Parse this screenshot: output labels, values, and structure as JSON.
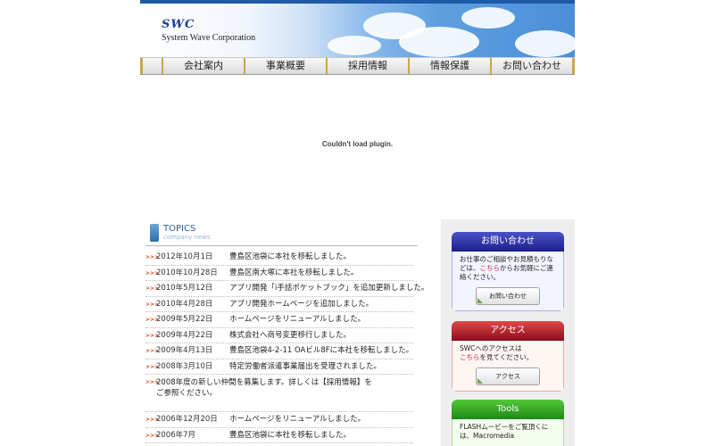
{
  "header": {
    "logo_mark": "SWC",
    "logo_sub": "System Wave Corporation"
  },
  "nav": {
    "items": [
      {
        "label": "会社案内"
      },
      {
        "label": "事業概要"
      },
      {
        "label": "採用情報"
      },
      {
        "label": "情報保護"
      },
      {
        "label": "お問い合わせ"
      }
    ]
  },
  "plugin": {
    "message": "Couldn't load plugin."
  },
  "topics": {
    "title": "TOPICS",
    "subtitle": "company news",
    "bullet": ">>>",
    "items": [
      {
        "date": "2012年10月1日",
        "text": "豊島区池袋に本社を移転しました。"
      },
      {
        "date": "2010年10月28日",
        "text": "豊島区南大塚に本社を移転しました。"
      },
      {
        "date": "2010年5月12日",
        "text": "アプリ開発「i手話ポケットブック」を追加更新しました。"
      },
      {
        "date": "2010年4月28日",
        "text": "アプリ開発ホームページを追加しました。"
      },
      {
        "date": "2009年5月22日",
        "text": "ホームページをリニューアルしました。"
      },
      {
        "date": "2009年4月22日",
        "text": "株式会社へ商号変更移行しました。"
      },
      {
        "date": "2009年4月13日",
        "text": "豊島区池袋4-2-11 OAビル8Fに本社を移転しました。"
      },
      {
        "date": "2008年3月10日",
        "text": "特定労働者派遣事業届出を受理されました。"
      },
      {
        "date": "",
        "text": "2008年度の新しい仲間を募集します。詳しくは【採用情報】をご参照ください。"
      },
      {
        "date": "2006年12月20日",
        "text": "ホームページをリニューアルしました。"
      },
      {
        "date": "2006年7月",
        "text": "豊島区池袋に本社を移転しました。"
      }
    ]
  },
  "sidebar": {
    "contact": {
      "title": "お問い合わせ",
      "text_1": "お仕事のご相談やお見積もりなどは、",
      "link": "こちら",
      "text_2": "からお気軽にご連絡ください。",
      "button": "お問い合わせ"
    },
    "access": {
      "title": "アクセス",
      "text_1": "SWCへのアクセスは",
      "link": "こちら",
      "text_2": "を見てください。",
      "button": "アクセス"
    },
    "tools": {
      "title": "Tools",
      "text": "FLASHムービーをご覧頂くには、Macromedia"
    }
  }
}
